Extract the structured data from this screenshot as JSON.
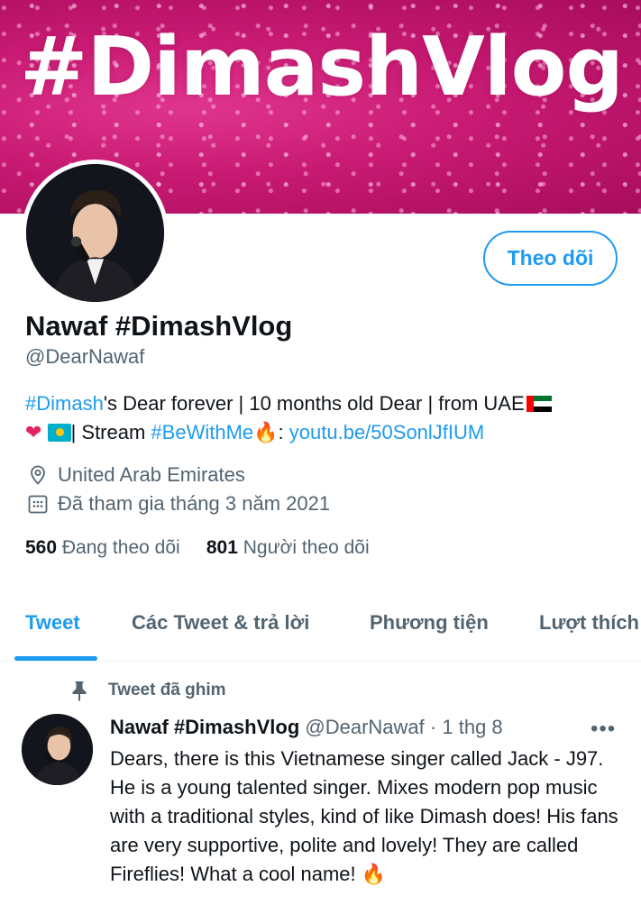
{
  "banner": {
    "text": "#DimashVlog"
  },
  "profile": {
    "display_name": "Nawaf #DimashVlog",
    "handle": "@DearNawaf",
    "follow_label": "Theo dõi",
    "bio": {
      "line1_hashtag": "#Dimash",
      "line1_text": "'s Dear forever | 10 months old Dear | from UAE",
      "line2_text": "| Stream ",
      "line2_hashtag": "#BeWithMe",
      "line2_colon": ": ",
      "line2_link": "youtu.be/50SonlJfIUM"
    },
    "location": "United Arab Emirates",
    "joined": "Đã tham gia tháng 3 năm 2021",
    "following_count": "560",
    "following_label": "Đang theo dõi",
    "followers_count": "801",
    "followers_label": "Người theo dõi"
  },
  "tabs": [
    {
      "label": "Tweet"
    },
    {
      "label": "Các Tweet & trả lời"
    },
    {
      "label": "Phương tiện"
    },
    {
      "label": "Lượt thích"
    }
  ],
  "pinned_tweet": {
    "pinned_label": "Tweet đã ghim",
    "author_name": "Nawaf #DimashVlog",
    "author_handle": "@DearNawaf",
    "separator": "·",
    "time": "1 thg 8",
    "text": "Dears, there is this Vietnamese singer called Jack - J97. He is a young talented singer. Mixes modern pop music with a traditional styles, kind of like Dimash does! His fans are very supportive, polite and lovely! They are called Fireflies! What a cool name! 🔥"
  },
  "colors": {
    "accent": "#1d9bf0",
    "banner": "#c81a73",
    "secondary_text": "#536471"
  },
  "icons": {
    "location": "location-pin-icon",
    "calendar": "calendar-icon",
    "pin": "pin-icon",
    "more": "more-horizontal-icon"
  }
}
